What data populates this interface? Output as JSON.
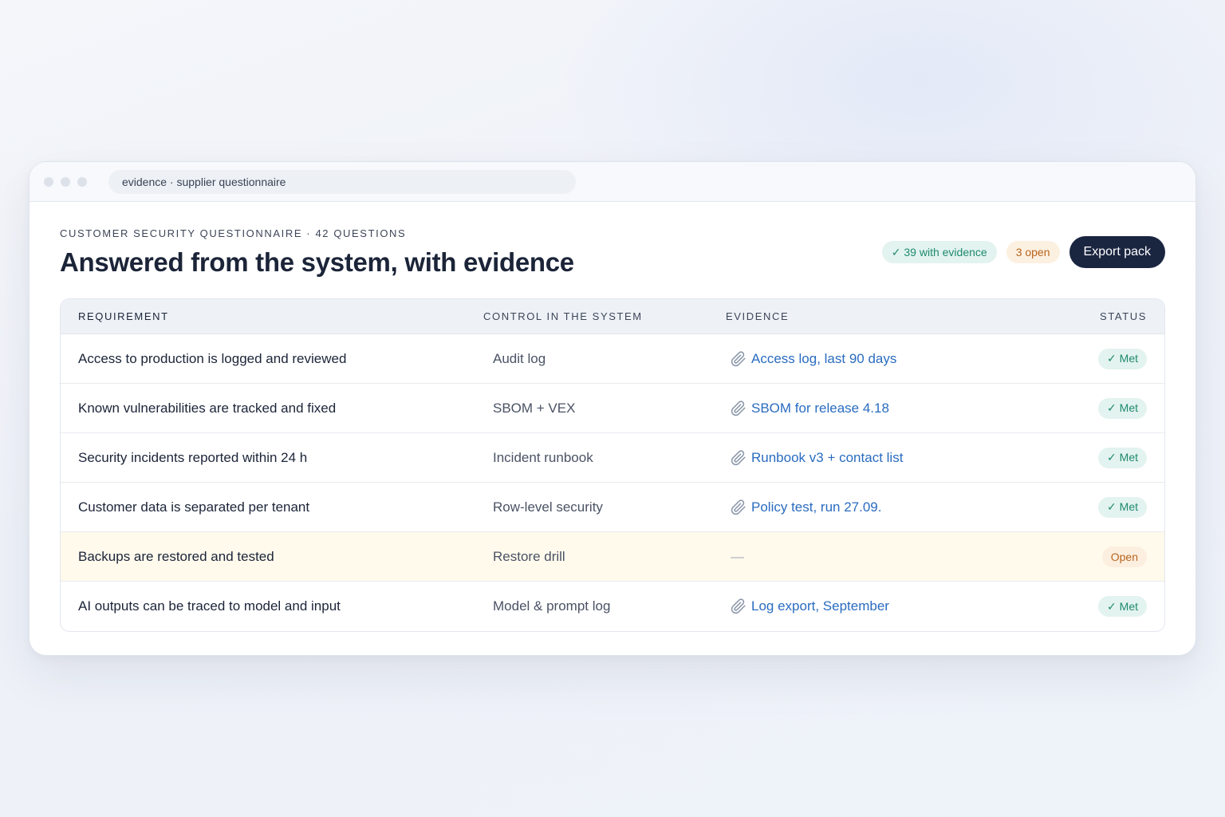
{
  "window": {
    "url": "evidence · supplier questionnaire"
  },
  "header": {
    "eyebrow": "CUSTOMER SECURITY QUESTIONNAIRE · 42 QUESTIONS",
    "title": "Answered from the system, with evidence",
    "chip_evidence": "✓ 39 with evidence",
    "chip_open": "3 open",
    "export_label": "Export pack"
  },
  "table": {
    "columns": [
      "REQUIREMENT",
      "CONTROL IN THE SYSTEM",
      "EVIDENCE",
      "STATUS"
    ],
    "rows": [
      {
        "requirement": "Access to production is logged and reviewed",
        "control": "Audit log",
        "evidence": "Access log, last 90 days",
        "status": "✓ Met"
      },
      {
        "requirement": "Known vulnerabilities are tracked and fixed",
        "control": "SBOM + VEX",
        "evidence": "SBOM for release 4.18",
        "status": "✓ Met"
      },
      {
        "requirement": "Security incidents reported within 24 h",
        "control": "Incident runbook",
        "evidence": "Runbook v3 + contact list",
        "status": "✓ Met"
      },
      {
        "requirement": "Customer data is separated per tenant",
        "control": "Row-level security",
        "evidence": "Policy test, run 27.09.",
        "status": "✓ Met"
      },
      {
        "requirement": "Backups are restored and tested",
        "control": "Restore drill",
        "evidence": "—",
        "status": "Open"
      },
      {
        "requirement": "AI outputs can be traced to model and input",
        "control": "Model & prompt log",
        "evidence": "Log export, September",
        "status": "✓ Met"
      }
    ]
  },
  "colors": {
    "accent_dark": "#1a2540",
    "link": "#2a6cc0",
    "met": "#1e8a6c",
    "open": "#b8641c",
    "highlight_row": "#fffaec"
  },
  "icons": {
    "evidence": "paperclip-icon"
  }
}
